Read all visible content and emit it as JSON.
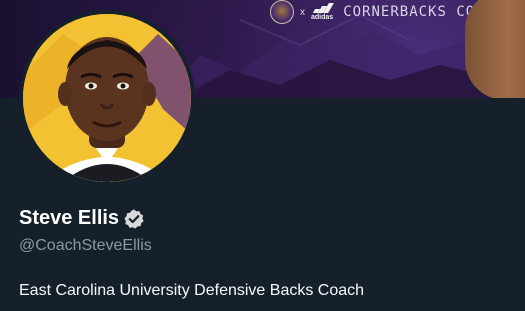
{
  "banner": {
    "separator": "x",
    "brand": "adidas",
    "tagline": "CORNERBACKS COACH"
  },
  "profile": {
    "display_name": "Steve Ellis",
    "handle": "@CoachSteveEllis",
    "bio": "East Carolina University Defensive Backs Coach",
    "verified": true
  },
  "colors": {
    "background": "#15202b",
    "name": "#ffffff",
    "handle": "#8b98a5",
    "bio": "#f7f9f9",
    "avatar_backdrop": "#f2c233",
    "banner_purple": "#2e1a4d"
  },
  "icons": {
    "verified": "verified-badge-icon",
    "seal": "university-seal-icon",
    "brand": "adidas-logo-icon"
  }
}
